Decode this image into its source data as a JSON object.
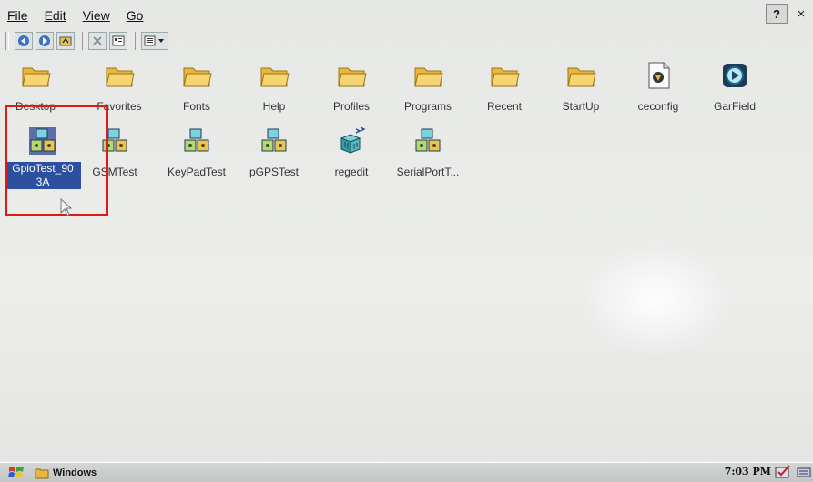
{
  "menu": {
    "file": "File",
    "edit": "Edit",
    "view": "View",
    "go": "Go"
  },
  "window_buttons": {
    "help": "?",
    "close": "×"
  },
  "toolbar": {
    "icons": [
      "back-icon",
      "forward-icon",
      "up-folder-icon",
      "delete-icon",
      "properties-icon",
      "views-menu-icon"
    ]
  },
  "row1": [
    {
      "label": "Desktop",
      "icon": "folder-icon"
    },
    {
      "label": "Favorites",
      "icon": "folder-icon"
    },
    {
      "label": "Fonts",
      "icon": "folder-icon"
    },
    {
      "label": "Help",
      "icon": "folder-icon"
    },
    {
      "label": "Profiles",
      "icon": "folder-icon"
    },
    {
      "label": "Programs",
      "icon": "folder-icon"
    },
    {
      "label": "Recent",
      "icon": "folder-icon"
    },
    {
      "label": "StartUp",
      "icon": "folder-icon"
    },
    {
      "label": "ceconfig",
      "icon": "config-file-icon"
    },
    {
      "label": "GarField",
      "icon": "media-app-icon"
    }
  ],
  "row2": [
    {
      "label": "GpioTest_903A",
      "icon": "app-cubes-icon",
      "selected": true
    },
    {
      "label": "GSMTest",
      "icon": "app-cubes-icon"
    },
    {
      "label": "KeyPadTest",
      "icon": "app-cubes-icon"
    },
    {
      "label": "pGPSTest",
      "icon": "app-cubes-icon"
    },
    {
      "label": "regedit",
      "icon": "regedit-icon"
    },
    {
      "label": "SerialPortT...",
      "icon": "app-cubes-icon"
    }
  ],
  "selected_label_lines": [
    "GpioTest_90",
    "3A"
  ],
  "taskbar": {
    "window_label": "Windows",
    "clock": "7:03 PM"
  },
  "colors": {
    "selection": "#2d4fa0",
    "highlight_box": "#e01818",
    "folder": "#f2c94c"
  }
}
